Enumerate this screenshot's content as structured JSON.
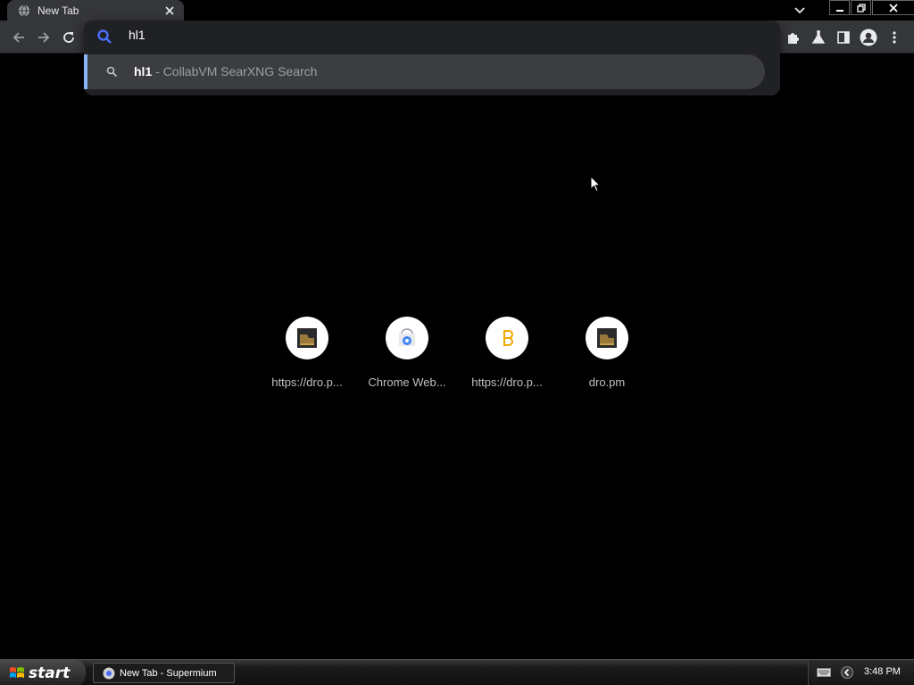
{
  "tab": {
    "title": "New Tab",
    "favicon": "globe-icon"
  },
  "omnibox": {
    "query": "hl1",
    "suggestion": {
      "query": "hl1",
      "separator": " - ",
      "engine": "CollabVM SearXNG Search"
    }
  },
  "tiles": [
    {
      "label": "https://dro.p...",
      "icon": "dro-logo-icon"
    },
    {
      "label": "Chrome Web...",
      "icon": "chrome-web-store-icon"
    },
    {
      "label": "https://dro.p...",
      "icon": "yellow-b-icon"
    },
    {
      "label": "dro.pm",
      "icon": "dro-logo-icon"
    }
  ],
  "taskbar": {
    "start_label": "start",
    "task_label": "New Tab - Supermium",
    "clock": "3:48 PM"
  },
  "colors": {
    "accent": "#8ab4f8",
    "search_icon": "#4a6cf7",
    "toolbar": "#35363a",
    "omnibox_bg": "#202124"
  }
}
